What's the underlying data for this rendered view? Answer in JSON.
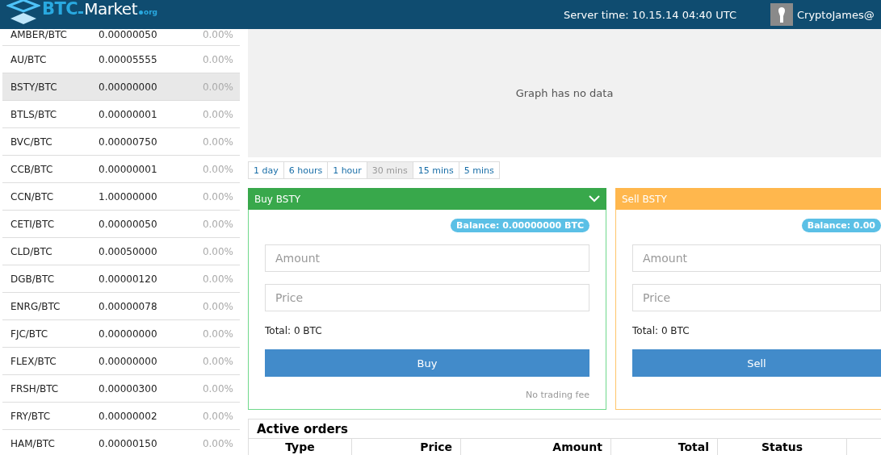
{
  "header": {
    "logo": {
      "brand": "BTC",
      "name": "Market",
      "tld": "org"
    },
    "server_time": "Server time: 10.15.14 04:40 UTC",
    "user": "CryptoJames@"
  },
  "markets": [
    {
      "pair": "AMBER/BTC",
      "price": "0.00000050",
      "change": "0.00%",
      "selected": false
    },
    {
      "pair": "AU/BTC",
      "price": "0.00005555",
      "change": "0.00%",
      "selected": false
    },
    {
      "pair": "BSTY/BTC",
      "price": "0.00000000",
      "change": "0.00%",
      "selected": true
    },
    {
      "pair": "BTLS/BTC",
      "price": "0.00000001",
      "change": "0.00%",
      "selected": false
    },
    {
      "pair": "BVC/BTC",
      "price": "0.00000750",
      "change": "0.00%",
      "selected": false
    },
    {
      "pair": "CCB/BTC",
      "price": "0.00000001",
      "change": "0.00%",
      "selected": false
    },
    {
      "pair": "CCN/BTC",
      "price": "1.00000000",
      "change": "0.00%",
      "selected": false
    },
    {
      "pair": "CETI/BTC",
      "price": "0.00000050",
      "change": "0.00%",
      "selected": false
    },
    {
      "pair": "CLD/BTC",
      "price": "0.00050000",
      "change": "0.00%",
      "selected": false
    },
    {
      "pair": "DGB/BTC",
      "price": "0.00000120",
      "change": "0.00%",
      "selected": false
    },
    {
      "pair": "ENRG/BTC",
      "price": "0.00000078",
      "change": "0.00%",
      "selected": false
    },
    {
      "pair": "FJC/BTC",
      "price": "0.00000000",
      "change": "0.00%",
      "selected": false
    },
    {
      "pair": "FLEX/BTC",
      "price": "0.00000000",
      "change": "0.00%",
      "selected": false
    },
    {
      "pair": "FRSH/BTC",
      "price": "0.00000300",
      "change": "0.00%",
      "selected": false
    },
    {
      "pair": "FRY/BTC",
      "price": "0.00000002",
      "change": "0.00%",
      "selected": false
    },
    {
      "pair": "HAM/BTC",
      "price": "0.00000150",
      "change": "0.00%",
      "selected": false
    }
  ],
  "chart": {
    "message": "Graph has no data"
  },
  "time_ranges": [
    {
      "label": "1 day",
      "selected": false
    },
    {
      "label": "6 hours",
      "selected": false
    },
    {
      "label": "1 hour",
      "selected": false
    },
    {
      "label": "30 mins",
      "selected": true
    },
    {
      "label": "15 mins",
      "selected": false
    },
    {
      "label": "5 mins",
      "selected": false
    }
  ],
  "trade_panels": [
    {
      "kind": "buy",
      "title": "Buy BSTY",
      "balance": "Balance: 0.00000000 BTC",
      "amount_placeholder": "Amount",
      "price_placeholder": "Price",
      "total": "Total: 0 BTC",
      "button": "Buy",
      "fee_note": "No trading fee"
    },
    {
      "kind": "sell",
      "title": "Sell BSTY",
      "balance": "Balance: 0.00",
      "amount_placeholder": "Amount",
      "price_placeholder": "Price",
      "total": "Total: 0 BTC",
      "button": "Sell"
    }
  ],
  "active_orders": {
    "title": "Active orders",
    "columns": [
      "Type",
      "Price",
      "Amount",
      "Total",
      "Status"
    ]
  }
}
